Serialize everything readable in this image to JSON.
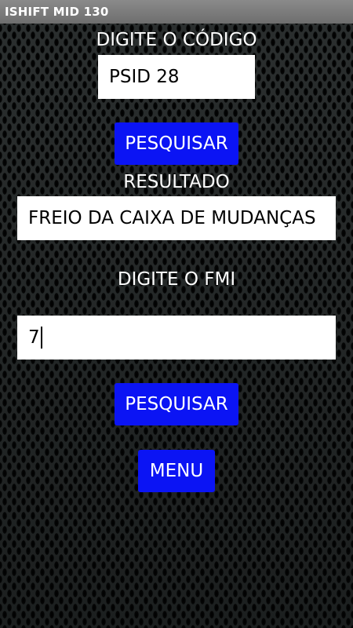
{
  "titlebar": {
    "title": "ISHIFT MID 130"
  },
  "code_section": {
    "label": "DIGITE O CÓDIGO",
    "input_value": "PSID 28",
    "search_button": "PESQUISAR"
  },
  "result_section": {
    "label": "RESULTADO",
    "value": "FREIO DA CAIXA DE MUDANÇAS"
  },
  "fmi_section": {
    "label": "DIGITE O FMI",
    "input_value": "7",
    "search_button": "PESQUISAR"
  },
  "menu_button": "MENU",
  "colors": {
    "button": "#0b14f4",
    "titlebar": "#7c7c7c",
    "field": "#ffffff"
  }
}
